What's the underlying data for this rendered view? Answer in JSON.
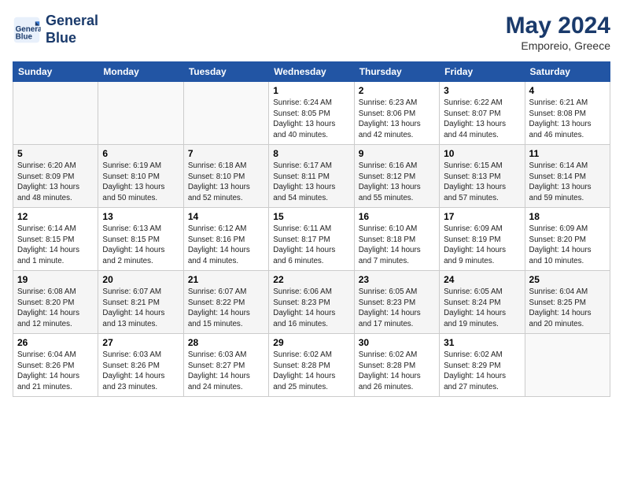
{
  "logo": {
    "name_line1": "General",
    "name_line2": "Blue"
  },
  "title": {
    "month_year": "May 2024",
    "location": "Emporeio, Greece"
  },
  "weekdays": [
    "Sunday",
    "Monday",
    "Tuesday",
    "Wednesday",
    "Thursday",
    "Friday",
    "Saturday"
  ],
  "weeks": [
    [
      {
        "day": "",
        "info": ""
      },
      {
        "day": "",
        "info": ""
      },
      {
        "day": "",
        "info": ""
      },
      {
        "day": "1",
        "info": "Sunrise: 6:24 AM\nSunset: 8:05 PM\nDaylight: 13 hours\nand 40 minutes."
      },
      {
        "day": "2",
        "info": "Sunrise: 6:23 AM\nSunset: 8:06 PM\nDaylight: 13 hours\nand 42 minutes."
      },
      {
        "day": "3",
        "info": "Sunrise: 6:22 AM\nSunset: 8:07 PM\nDaylight: 13 hours\nand 44 minutes."
      },
      {
        "day": "4",
        "info": "Sunrise: 6:21 AM\nSunset: 8:08 PM\nDaylight: 13 hours\nand 46 minutes."
      }
    ],
    [
      {
        "day": "5",
        "info": "Sunrise: 6:20 AM\nSunset: 8:09 PM\nDaylight: 13 hours\nand 48 minutes."
      },
      {
        "day": "6",
        "info": "Sunrise: 6:19 AM\nSunset: 8:10 PM\nDaylight: 13 hours\nand 50 minutes."
      },
      {
        "day": "7",
        "info": "Sunrise: 6:18 AM\nSunset: 8:10 PM\nDaylight: 13 hours\nand 52 minutes."
      },
      {
        "day": "8",
        "info": "Sunrise: 6:17 AM\nSunset: 8:11 PM\nDaylight: 13 hours\nand 54 minutes."
      },
      {
        "day": "9",
        "info": "Sunrise: 6:16 AM\nSunset: 8:12 PM\nDaylight: 13 hours\nand 55 minutes."
      },
      {
        "day": "10",
        "info": "Sunrise: 6:15 AM\nSunset: 8:13 PM\nDaylight: 13 hours\nand 57 minutes."
      },
      {
        "day": "11",
        "info": "Sunrise: 6:14 AM\nSunset: 8:14 PM\nDaylight: 13 hours\nand 59 minutes."
      }
    ],
    [
      {
        "day": "12",
        "info": "Sunrise: 6:14 AM\nSunset: 8:15 PM\nDaylight: 14 hours\nand 1 minute."
      },
      {
        "day": "13",
        "info": "Sunrise: 6:13 AM\nSunset: 8:15 PM\nDaylight: 14 hours\nand 2 minutes."
      },
      {
        "day": "14",
        "info": "Sunrise: 6:12 AM\nSunset: 8:16 PM\nDaylight: 14 hours\nand 4 minutes."
      },
      {
        "day": "15",
        "info": "Sunrise: 6:11 AM\nSunset: 8:17 PM\nDaylight: 14 hours\nand 6 minutes."
      },
      {
        "day": "16",
        "info": "Sunrise: 6:10 AM\nSunset: 8:18 PM\nDaylight: 14 hours\nand 7 minutes."
      },
      {
        "day": "17",
        "info": "Sunrise: 6:09 AM\nSunset: 8:19 PM\nDaylight: 14 hours\nand 9 minutes."
      },
      {
        "day": "18",
        "info": "Sunrise: 6:09 AM\nSunset: 8:20 PM\nDaylight: 14 hours\nand 10 minutes."
      }
    ],
    [
      {
        "day": "19",
        "info": "Sunrise: 6:08 AM\nSunset: 8:20 PM\nDaylight: 14 hours\nand 12 minutes."
      },
      {
        "day": "20",
        "info": "Sunrise: 6:07 AM\nSunset: 8:21 PM\nDaylight: 14 hours\nand 13 minutes."
      },
      {
        "day": "21",
        "info": "Sunrise: 6:07 AM\nSunset: 8:22 PM\nDaylight: 14 hours\nand 15 minutes."
      },
      {
        "day": "22",
        "info": "Sunrise: 6:06 AM\nSunset: 8:23 PM\nDaylight: 14 hours\nand 16 minutes."
      },
      {
        "day": "23",
        "info": "Sunrise: 6:05 AM\nSunset: 8:23 PM\nDaylight: 14 hours\nand 17 minutes."
      },
      {
        "day": "24",
        "info": "Sunrise: 6:05 AM\nSunset: 8:24 PM\nDaylight: 14 hours\nand 19 minutes."
      },
      {
        "day": "25",
        "info": "Sunrise: 6:04 AM\nSunset: 8:25 PM\nDaylight: 14 hours\nand 20 minutes."
      }
    ],
    [
      {
        "day": "26",
        "info": "Sunrise: 6:04 AM\nSunset: 8:26 PM\nDaylight: 14 hours\nand 21 minutes."
      },
      {
        "day": "27",
        "info": "Sunrise: 6:03 AM\nSunset: 8:26 PM\nDaylight: 14 hours\nand 23 minutes."
      },
      {
        "day": "28",
        "info": "Sunrise: 6:03 AM\nSunset: 8:27 PM\nDaylight: 14 hours\nand 24 minutes."
      },
      {
        "day": "29",
        "info": "Sunrise: 6:02 AM\nSunset: 8:28 PM\nDaylight: 14 hours\nand 25 minutes."
      },
      {
        "day": "30",
        "info": "Sunrise: 6:02 AM\nSunset: 8:28 PM\nDaylight: 14 hours\nand 26 minutes."
      },
      {
        "day": "31",
        "info": "Sunrise: 6:02 AM\nSunset: 8:29 PM\nDaylight: 14 hours\nand 27 minutes."
      },
      {
        "day": "",
        "info": ""
      }
    ]
  ]
}
